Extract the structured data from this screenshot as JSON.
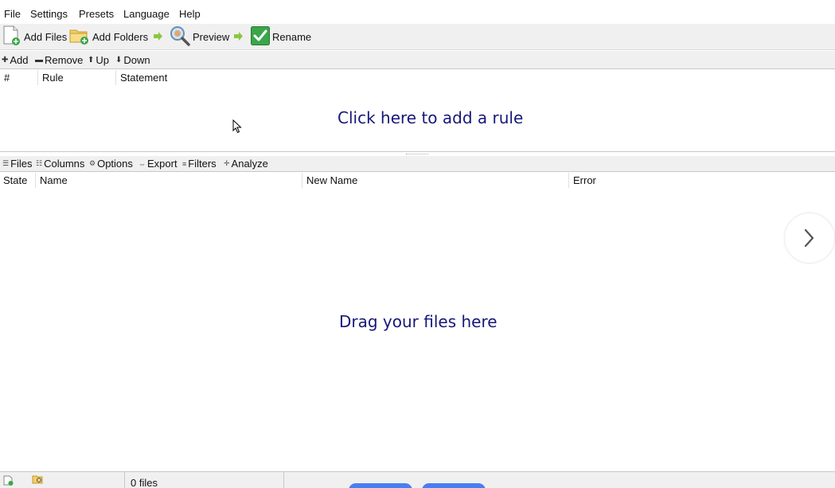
{
  "menu": [
    "File",
    "Settings",
    "Presets",
    "Language",
    "Help"
  ],
  "toolbar": {
    "add_files": "Add Files",
    "add_folders": "Add Folders",
    "preview": "Preview",
    "rename": "Rename"
  },
  "rules_toolbar": {
    "add": "Add",
    "remove": "Remove",
    "up": "Up",
    "down": "Down"
  },
  "rules_columns": [
    "#",
    "Rule",
    "Statement"
  ],
  "rules_hint": "Click here to add a rule",
  "files_toolbar": {
    "files": "Files",
    "columns": "Columns",
    "options": "Options",
    "export": "Export",
    "filters": "Filters",
    "analyze": "Analyze"
  },
  "files_columns": [
    "State",
    "Name",
    "New Name",
    "Error"
  ],
  "files_hint": "Drag your files here",
  "status": {
    "file_count": "0 files"
  },
  "colors": {
    "hint": "#17177a",
    "accent_green": "#3aa64a",
    "arrow_green": "#8cc63f",
    "pill_blue": "#4a7ef0"
  }
}
